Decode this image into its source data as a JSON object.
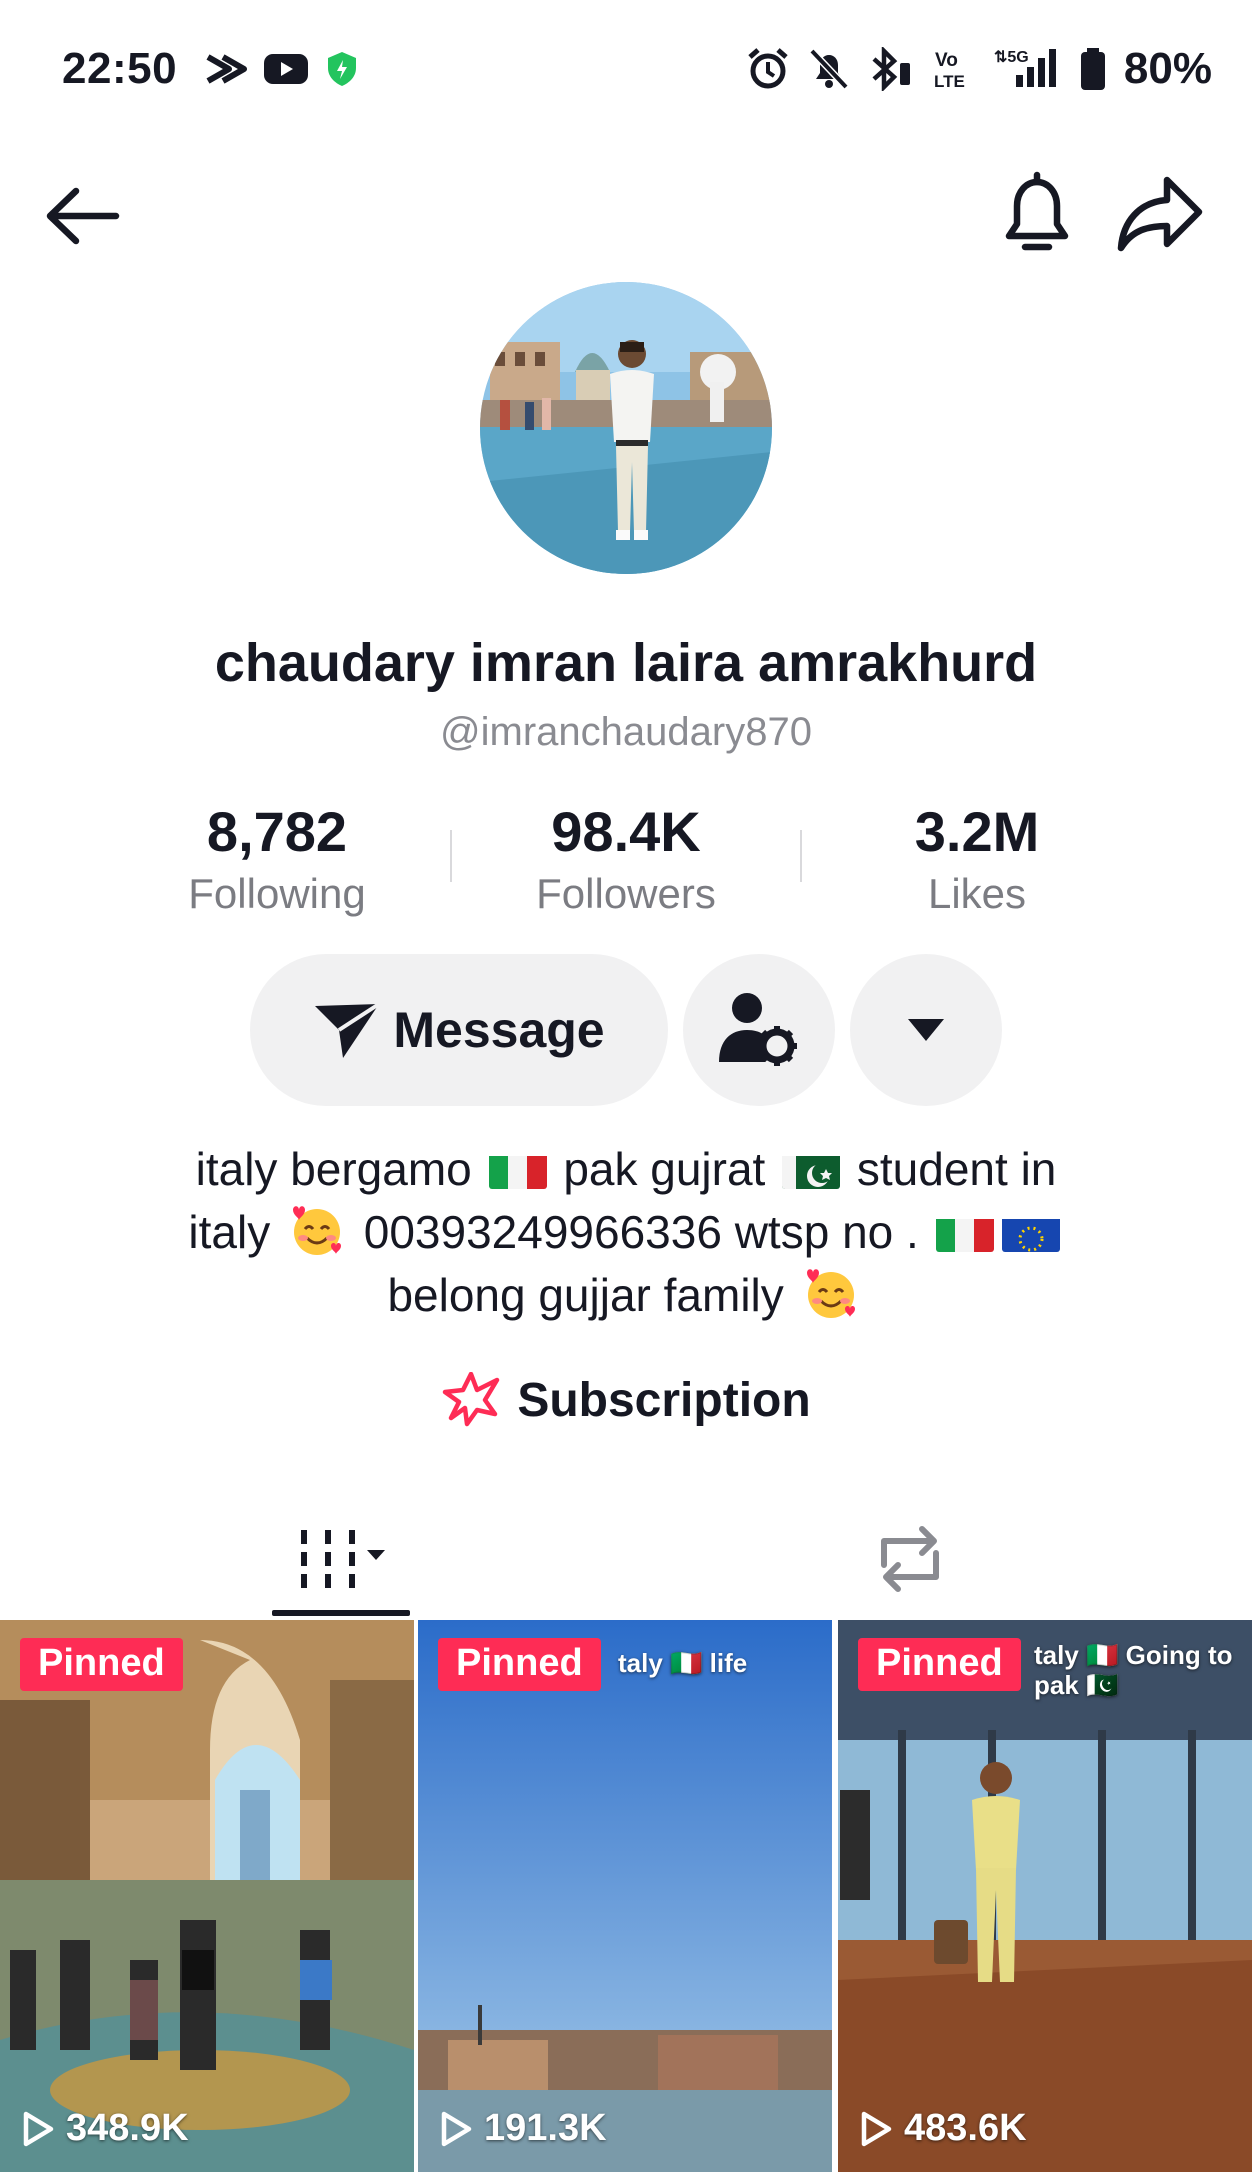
{
  "status_bar": {
    "time": "22:50",
    "battery": "80%",
    "left_icons": [
      "capcut-icon",
      "youtube-icon",
      "shield-icon"
    ],
    "right_icons": [
      "alarm-icon",
      "bell-off-icon",
      "bluetooth-icon",
      "volte-icon",
      "5g-signal-icon",
      "battery-icon"
    ]
  },
  "profile": {
    "display_name": "chaudary imran laira amrakhurd",
    "username": "@imranchaudary870"
  },
  "stats": [
    {
      "value": "8,782",
      "label": "Following"
    },
    {
      "value": "98.4K",
      "label": "Followers"
    },
    {
      "value": "3.2M",
      "label": "Likes"
    }
  ],
  "actions": {
    "message_label": "Message"
  },
  "bio": {
    "line1_a": "italy bergamo",
    "line1_b": "pak gujrat",
    "line1_c": "student in",
    "line2_a": "italy",
    "line2_b": "00393249966336 wtsp no .",
    "line3_a": "belong gujjar family"
  },
  "subscription": {
    "label": "Subscription"
  },
  "videos": [
    {
      "badge": "Pinned",
      "views": "348.9K"
    },
    {
      "badge": "Pinned",
      "views": "191.3K",
      "overlay": "taly 🇮🇹 life"
    },
    {
      "badge": "Pinned",
      "views": "483.6K",
      "overlay": "taly 🇮🇹 Going to pak 🇵🇰"
    }
  ],
  "colors": {
    "accent": "#fe2c55",
    "text": "#161823",
    "muted": "#8a8b91",
    "button_bg": "#f1f1f2"
  }
}
